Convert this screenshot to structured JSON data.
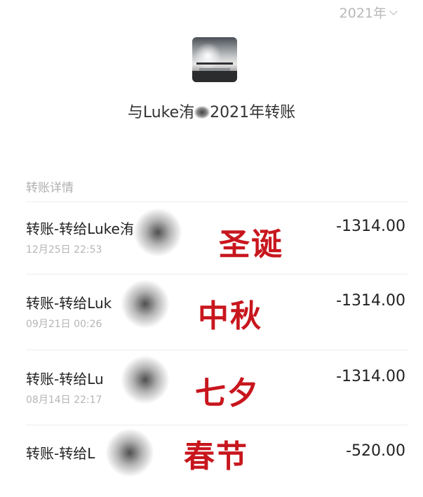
{
  "header": {
    "year": "2021年"
  },
  "title": {
    "prefix": "与Luke洧",
    "suffix": "2021年转账"
  },
  "section_label": "转账详情",
  "transactions": [
    {
      "desc": "转账-转给Luke洧",
      "time": "12月25日 22:53",
      "amount": "-1314.00",
      "note": "圣诞"
    },
    {
      "desc": "转账-转给Luk",
      "time": "09月21日 00:26",
      "amount": "-1314.00",
      "note": "中秋"
    },
    {
      "desc": "转账-转给Lu",
      "time": "08月14日 22:17",
      "amount": "-1314.00",
      "note": "七夕"
    },
    {
      "desc": "转账-转给L",
      "time": "",
      "amount": "-520.00",
      "note": "春节"
    }
  ]
}
